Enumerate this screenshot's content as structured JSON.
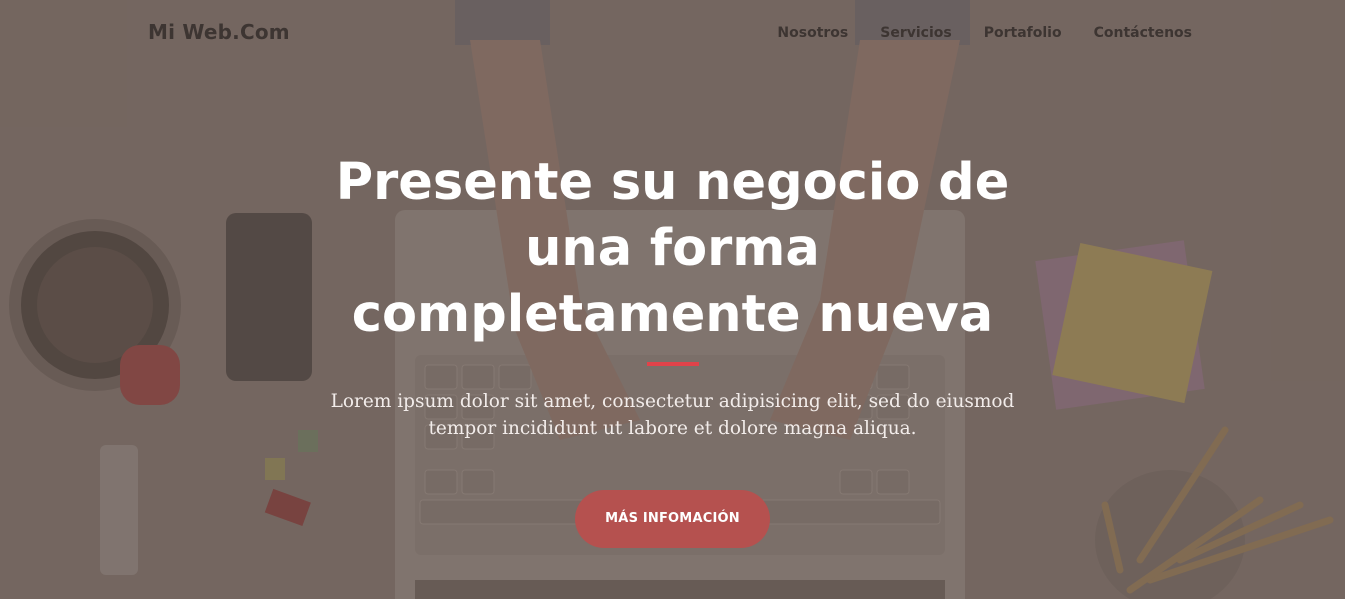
{
  "navbar": {
    "brand": "Mi Web.Com",
    "links": [
      "Nosotros",
      "Servicios",
      "Portafolio",
      "Contáctenos"
    ]
  },
  "hero": {
    "headline_line1": "Presente su negocio de",
    "headline_line2": "una forma",
    "headline_line3": "completamente nueva",
    "lead_line1": "Lorem ipsum dolor sit amet, consectetur adipisicing elit, sed do eiusmod",
    "lead_line2": "tempor incididunt ut labore et dolore magna aliqua.",
    "cta_label": "MÁS INFOMACIÓN"
  },
  "colors": {
    "accent": "#e0434a",
    "button": "#b5514f",
    "nav_text": "#3d3532"
  }
}
